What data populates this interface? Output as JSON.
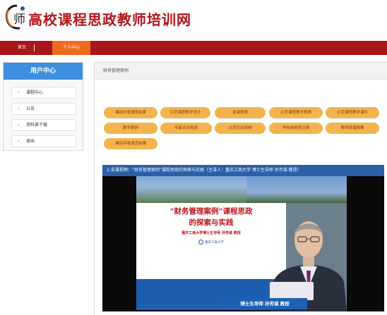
{
  "header": {
    "site_title": "高校课程思政教师培训网",
    "logo_glyph": "师"
  },
  "nav": {
    "items": [
      {
        "label": "首页"
      },
      {
        "label": "个人中心",
        "active": true
      }
    ],
    "colors": {
      "bar": "#a8151b",
      "active": "#ee6b1d"
    }
  },
  "sidebar": {
    "title": "用户中心",
    "items": [
      {
        "label": "课程中心"
      },
      {
        "label": "公告"
      },
      {
        "label": "资料表下载"
      },
      {
        "label": "退出"
      }
    ]
  },
  "main": {
    "breadcrumb": "财务管理案例",
    "tags": [
      "课前问卷调查结果",
      "示范课程教学设计",
      "说课视频",
      "示范课程教学视频",
      "示范课程教学课件",
      "教学案例",
      "专家点评视频",
      "交流互动视频",
      "学校审核意见表",
      "教师授课教案",
      "课后问卷调查结果"
    ]
  },
  "video": {
    "title": "2.说课视频：“财务管理案例”课程思政的探索与实践（主讲人：重庆工商大学 博士生导师 孙芳城 教授）",
    "slide": {
      "title_line1": "“财务管理案例”课程思政",
      "title_line2": "的探索与实践",
      "speaker_line": "重庆工商大学博士生导师  孙芳城  教授",
      "university": "重庆工商大学"
    },
    "caption": "博士生导师  孙芳城  教授"
  }
}
